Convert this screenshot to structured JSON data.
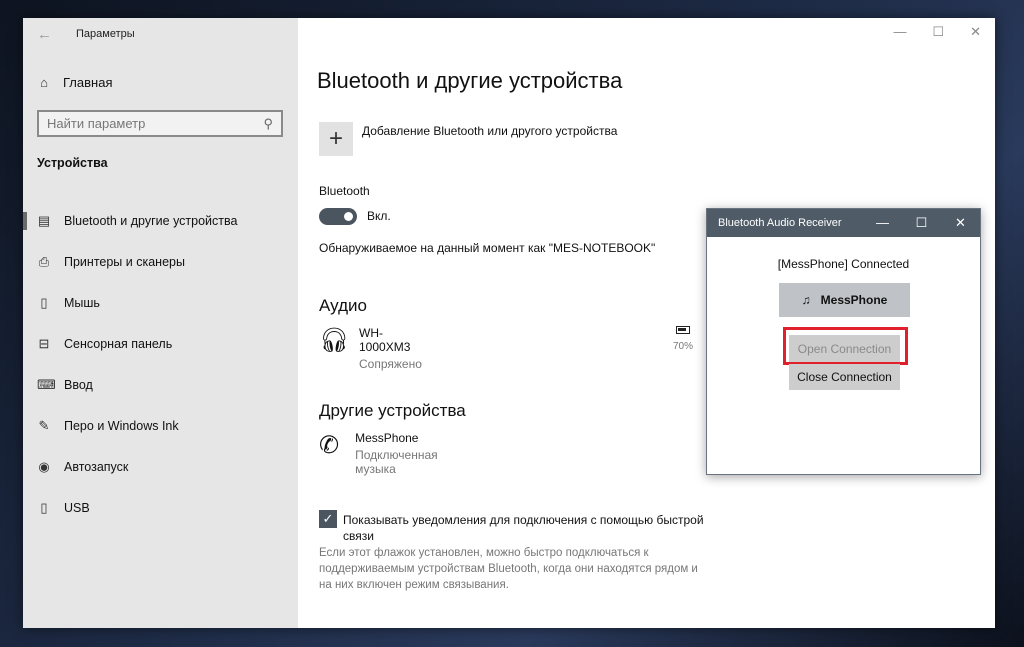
{
  "window": {
    "title": "Параметры",
    "minimize": "—",
    "maximize": "☐",
    "close": "✕"
  },
  "sidebar": {
    "home": "Главная",
    "search_placeholder": "Найти параметр",
    "section": "Устройства",
    "items": [
      {
        "label": "Bluetooth и другие устройства",
        "icon": "devices-icon"
      },
      {
        "label": "Принтеры и сканеры",
        "icon": "printer-icon"
      },
      {
        "label": "Мышь",
        "icon": "mouse-icon"
      },
      {
        "label": "Сенсорная панель",
        "icon": "touchpad-icon"
      },
      {
        "label": "Ввод",
        "icon": "keyboard-icon"
      },
      {
        "label": "Перо и Windows Ink",
        "icon": "pen-icon"
      },
      {
        "label": "Автозапуск",
        "icon": "autoplay-icon"
      },
      {
        "label": "USB",
        "icon": "usb-icon"
      }
    ]
  },
  "main": {
    "title": "Bluetooth и другие устройства",
    "add_label": "Добавление Bluetooth или другого устройства",
    "bluetooth_label": "Bluetooth",
    "toggle_state": "Вкл.",
    "discoverable": "Обнаруживаемое на данный момент как \"MES-NOTEBOOK\"",
    "audio_heading": "Аудио",
    "audio_device": {
      "name": "WH-1000XM3",
      "status": "Сопряжено",
      "battery": "70%"
    },
    "other_heading": "Другие устройства",
    "other_device": {
      "name": "MessPhone",
      "status": "Подключенная музыка"
    },
    "swift_pair_label": "Показывать уведомления для подключения с помощью быстрой связи",
    "swift_pair_checked": true,
    "swift_pair_help": "Если этот флажок установлен, можно быстро подключаться к поддерживаемым устройствам Bluetooth, когда они находятся рядом и на них включен режим связывания."
  },
  "popup": {
    "title": "Bluetooth Audio Receiver",
    "status": "[MessPhone] Connected",
    "device": "MessPhone",
    "open": "Open Connection",
    "close": "Close Connection",
    "highlight_color": "#e0202a"
  }
}
